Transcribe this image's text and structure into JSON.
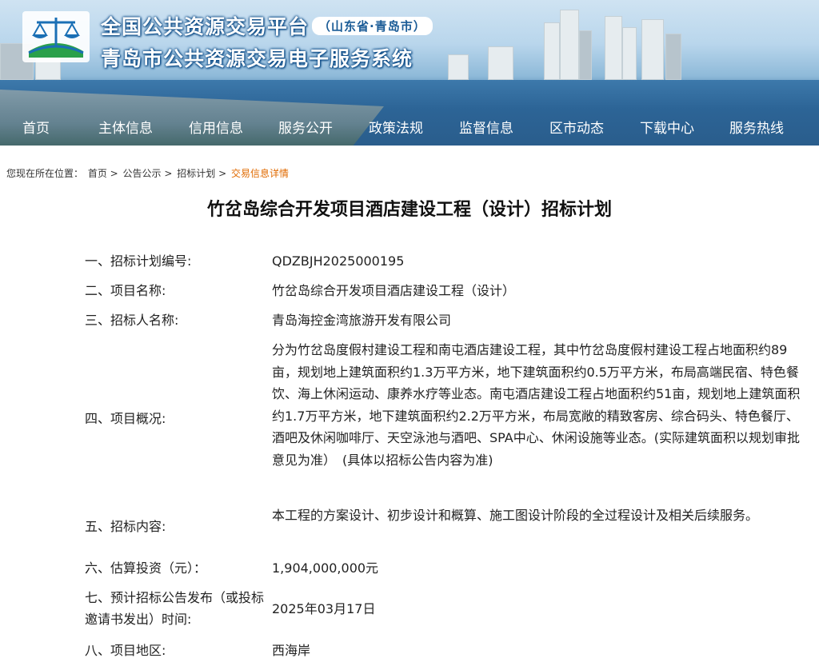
{
  "header": {
    "title_main": "全国公共资源交易平台",
    "title_region": "（山东省·青岛市）",
    "title_sub": "青岛市公共资源交易电子服务系统",
    "logo_icon": "scales-logo-icon"
  },
  "nav": {
    "items": [
      {
        "label": "首页"
      },
      {
        "label": "主体信息"
      },
      {
        "label": "信用信息"
      },
      {
        "label": "服务公开"
      },
      {
        "label": "政策法规"
      },
      {
        "label": "监督信息"
      },
      {
        "label": "区市动态"
      },
      {
        "label": "下载中心"
      },
      {
        "label": "服务热线"
      }
    ]
  },
  "breadcrumb": {
    "prefix": "您现在所在位置：",
    "items": [
      {
        "label": "首页 >"
      },
      {
        "label": "公告公示 >"
      },
      {
        "label": "招标计划 >"
      }
    ],
    "current": "交易信息详情"
  },
  "page": {
    "title": "竹岔岛综合开发项目酒店建设工程（设计）招标计划"
  },
  "details": {
    "rows": [
      {
        "label": "一、招标计划编号:",
        "value": "QDZBJH2025000195"
      },
      {
        "label": "二、项目名称:",
        "value": "竹岔岛综合开发项目酒店建设工程（设计）"
      },
      {
        "label": "三、招标人名称:",
        "value": "青岛海控金湾旅游开发有限公司"
      },
      {
        "label": "四、项目概况:",
        "value": "分为竹岔岛度假村建设工程和南屯酒店建设工程，其中竹岔岛度假村建设工程占地面积约89亩，规划地上建筑面积约1.3万平方米，地下建筑面积约0.5万平方米，布局高端民宿、特色餐饮、海上休闲运动、康养水疗等业态。南屯酒店建设工程占地面积约51亩，规划地上建筑面积约1.7万平方米，地下建筑面积约2.2万平方米，布局宽敞的精致客房、综合码头、特色餐厅、酒吧及休闲咖啡厅、天空泳池与酒吧、SPA中心、休闲设施等业态。(实际建筑面积以规划审批意见为准）　(具体以招标公告内容为准)"
      },
      {
        "label": "五、招标内容:",
        "value": "本工程的方案设计、初步设计和概算、施工图设计阶段的全过程设计及相关后续服务。"
      },
      {
        "label": "六、估算投资（元）：",
        "value": "1,904,000,000元"
      },
      {
        "label": "七、预计招标公告发布（或投标邀请书发出）时间:",
        "value": "2025年03月17日"
      },
      {
        "label": "八、项目地区:",
        "value": "西海岸"
      }
    ]
  },
  "colors": {
    "breadcrumb_current": "#e06a00",
    "nav_text": "#ffffff",
    "banner_sea": "#2c6496"
  }
}
